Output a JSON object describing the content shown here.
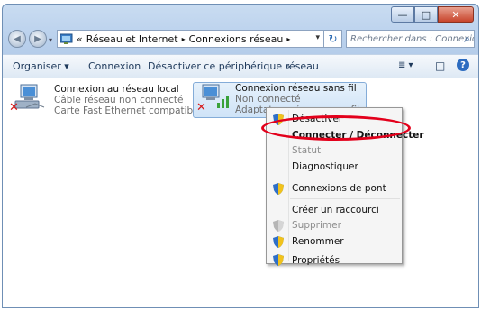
{
  "window": {
    "buttons": {
      "minimize": "—",
      "maximize": "□",
      "close": "✕"
    }
  },
  "address": {
    "prefix": "«",
    "crumbs": [
      "Réseau et Internet",
      "Connexions réseau"
    ],
    "separator": "▸",
    "dropdown": "▾",
    "refresh": "↻",
    "search_placeholder": "Rechercher dans : Connexions réseau"
  },
  "toolbar": {
    "organize": "Organiser ▾",
    "connect": "Connexion",
    "disable": "Désactiver ce périphérique réseau",
    "more": "»",
    "view": "≣ ▾",
    "pane": "□",
    "help": "?"
  },
  "connections": [
    {
      "name": "Connexion au réseau local",
      "status": "Câble réseau non connecté",
      "adapter": "Carte Fast Ethernet compatible R..."
    },
    {
      "name": "Connexion réseau sans fil",
      "status": "Non connecté",
      "adapter": "Adaptateur réseau sans fil"
    }
  ],
  "context_menu": {
    "items": [
      {
        "label": "Désactiver",
        "icon": "shield-icon"
      },
      {
        "label": "Connecter / Déconnecter",
        "bold": true
      },
      {
        "label": "Statut",
        "disabled": true
      },
      {
        "label": "Diagnostiquer"
      },
      {
        "label": "Connexions de pont",
        "icon": "shield-icon"
      },
      {
        "label": "Créer un raccourci"
      },
      {
        "label": "Supprimer",
        "icon": "shield-icon",
        "disabled": true
      },
      {
        "label": "Renommer",
        "icon": "shield-icon"
      },
      {
        "label": "Propriétés",
        "icon": "shield-icon"
      }
    ]
  },
  "colors": {
    "highlight_oval": "#e3001b",
    "accent": "#2d6cc0"
  }
}
